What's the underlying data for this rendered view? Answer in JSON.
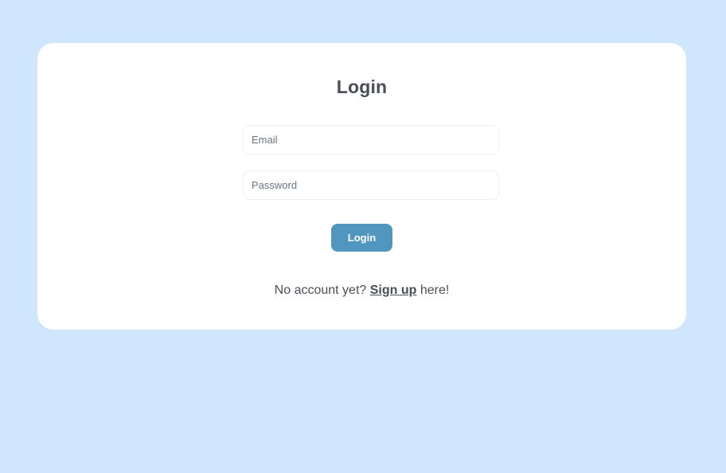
{
  "login": {
    "title": "Login",
    "email_placeholder": "Email",
    "email_value": "",
    "password_placeholder": "Password",
    "password_value": "",
    "button_label": "Login",
    "signup_prefix": "No account yet? ",
    "signup_link": "Sign up",
    "signup_suffix": " here!"
  },
  "colors": {
    "page_background": "#d0e6fd",
    "card_background": "#ffffff",
    "button_background": "#5096bf",
    "text": "#4a4f55"
  }
}
